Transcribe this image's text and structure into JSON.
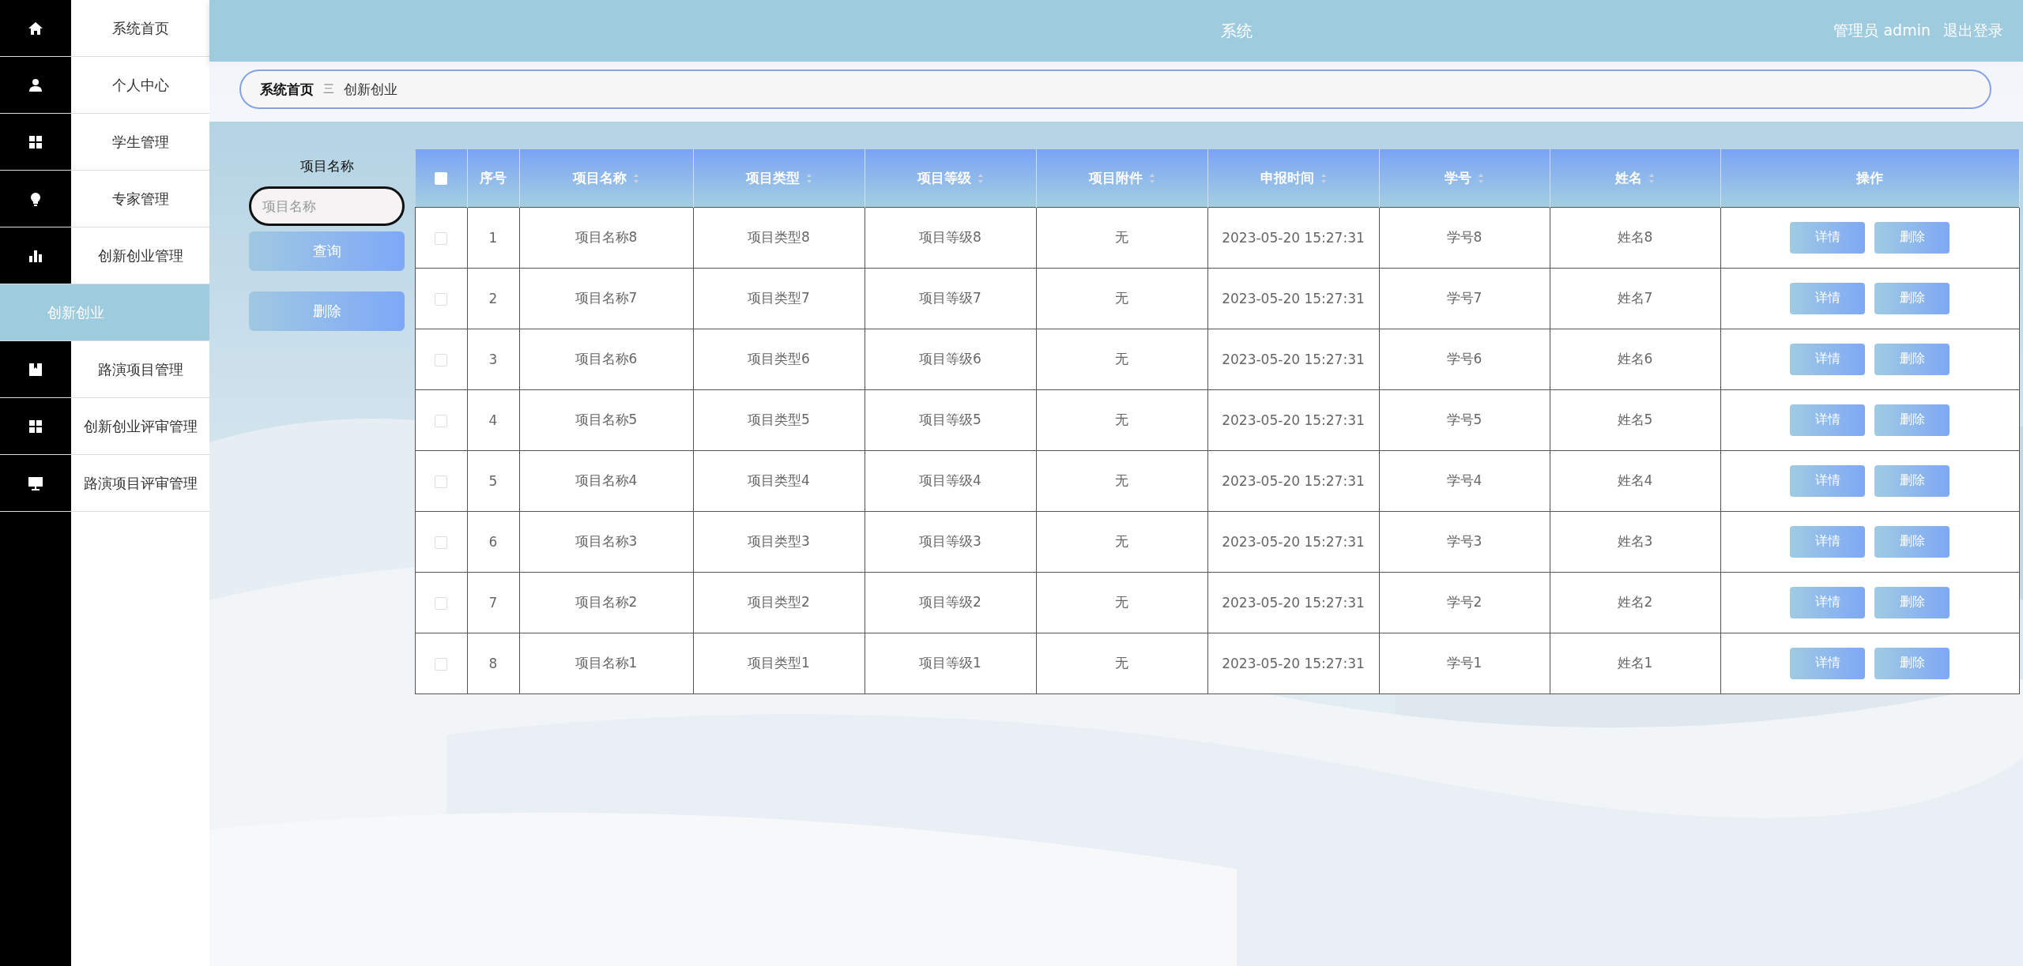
{
  "header": {
    "title": "系统",
    "user": "管理员 admin",
    "logout": "退出登录"
  },
  "menu": [
    {
      "label": "系统首页",
      "kind": "home",
      "selected": false
    },
    {
      "label": "个人中心",
      "kind": "user",
      "selected": false
    },
    {
      "label": "学生管理",
      "kind": "grid",
      "selected": false
    },
    {
      "label": "专家管理",
      "kind": "bulb",
      "selected": false
    },
    {
      "label": "创新创业管理",
      "kind": "chart",
      "selected": false,
      "children": [
        {
          "label": "创新创业",
          "selected": true
        }
      ]
    },
    {
      "label": "路演项目管理",
      "kind": "book",
      "selected": false
    },
    {
      "label": "创新创业评审管理",
      "kind": "grid",
      "selected": false
    },
    {
      "label": "路演项目评审管理",
      "kind": "monitor",
      "selected": false
    }
  ],
  "breadcrumb": [
    {
      "label": "系统首页",
      "kind": "link"
    },
    {
      "label": "三",
      "kind": "separator"
    },
    {
      "label": "创新创业",
      "kind": "current"
    }
  ],
  "search": {
    "label": "项目名称",
    "placeholder": "项目名称",
    "buttons": [
      "查询",
      "删除"
    ]
  },
  "table": {
    "select_all": {
      "checked": false
    },
    "columns": [
      {
        "label": "序号",
        "sortable": false
      },
      {
        "label": "项目名称",
        "sortable": true
      },
      {
        "label": "项目类型",
        "sortable": true
      },
      {
        "label": "项目等级",
        "sortable": true
      },
      {
        "label": "项目附件",
        "sortable": true
      },
      {
        "label": "申报时间",
        "sortable": true
      },
      {
        "label": "学号",
        "sortable": true
      },
      {
        "label": "姓名",
        "sortable": true
      },
      {
        "label": "操作",
        "sortable": false
      }
    ],
    "rows": [
      {
        "checked": false,
        "cells": [
          "1",
          "项目名称8",
          "项目类型8",
          "项目等级8",
          "无",
          "2023-05-20 15:27:31",
          "学号8",
          "姓名8"
        ],
        "actions": [
          "详情",
          "删除"
        ]
      },
      {
        "checked": false,
        "cells": [
          "2",
          "项目名称7",
          "项目类型7",
          "项目等级7",
          "无",
          "2023-05-20 15:27:31",
          "学号7",
          "姓名7"
        ],
        "actions": [
          "详情",
          "删除"
        ]
      },
      {
        "checked": false,
        "cells": [
          "3",
          "项目名称6",
          "项目类型6",
          "项目等级6",
          "无",
          "2023-05-20 15:27:31",
          "学号6",
          "姓名6"
        ],
        "actions": [
          "详情",
          "删除"
        ]
      },
      {
        "checked": false,
        "cells": [
          "4",
          "项目名称5",
          "项目类型5",
          "项目等级5",
          "无",
          "2023-05-20 15:27:31",
          "学号5",
          "姓名5"
        ],
        "actions": [
          "详情",
          "删除"
        ]
      },
      {
        "checked": false,
        "cells": [
          "5",
          "项目名称4",
          "项目类型4",
          "项目等级4",
          "无",
          "2023-05-20 15:27:31",
          "学号4",
          "姓名4"
        ],
        "actions": [
          "详情",
          "删除"
        ]
      },
      {
        "checked": false,
        "cells": [
          "6",
          "项目名称3",
          "项目类型3",
          "项目等级3",
          "无",
          "2023-05-20 15:27:31",
          "学号3",
          "姓名3"
        ],
        "actions": [
          "详情",
          "删除"
        ]
      },
      {
        "checked": false,
        "cells": [
          "7",
          "项目名称2",
          "项目类型2",
          "项目等级2",
          "无",
          "2023-05-20 15:27:31",
          "学号2",
          "姓名2"
        ],
        "actions": [
          "详情",
          "删除"
        ]
      },
      {
        "checked": false,
        "cells": [
          "8",
          "项目名称1",
          "项目类型1",
          "项目等级1",
          "无",
          "2023-05-20 15:27:31",
          "学号1",
          "姓名1"
        ],
        "actions": [
          "详情",
          "删除"
        ]
      }
    ]
  }
}
